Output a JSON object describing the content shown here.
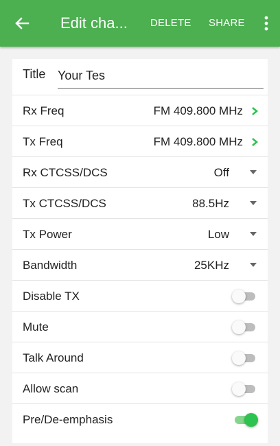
{
  "appbar": {
    "title": "Edit cha...",
    "delete_label": "DELETE",
    "share_label": "SHARE",
    "back_icon": "arrow-left-icon",
    "overflow_icon": "more-vertical-icon",
    "color": "#4caf50"
  },
  "form": {
    "title_label": "Title",
    "title_value": "Your Tes",
    "rows": [
      {
        "label": "Rx Freq",
        "value": "FM 409.800 MHz",
        "control": "chevron"
      },
      {
        "label": "Tx Freq",
        "value": "FM 409.800 MHz",
        "control": "chevron"
      },
      {
        "label": "Rx CTCSS/DCS",
        "value": "Off",
        "control": "dropdown"
      },
      {
        "label": "Tx CTCSS/DCS",
        "value": "88.5Hz",
        "control": "dropdown"
      },
      {
        "label": "Tx Power",
        "value": "Low",
        "control": "dropdown"
      },
      {
        "label": "Bandwidth",
        "value": "25KHz",
        "control": "dropdown"
      },
      {
        "label": "Disable TX",
        "control": "toggle",
        "on": false
      },
      {
        "label": "Mute",
        "control": "toggle",
        "on": false
      },
      {
        "label": "Talk Around",
        "control": "toggle",
        "on": false
      },
      {
        "label": "Allow scan",
        "control": "toggle",
        "on": false
      },
      {
        "label": "Pre/De-emphasis",
        "control": "toggle",
        "on": true
      }
    ]
  },
  "colors": {
    "accent": "#2ec250",
    "chevron": "#2ec250"
  }
}
